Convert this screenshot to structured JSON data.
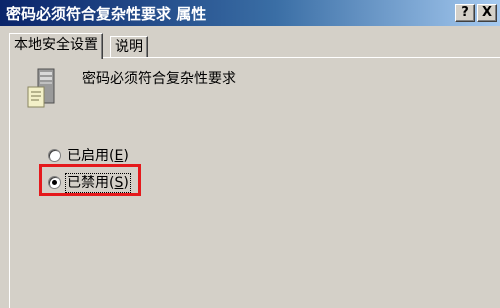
{
  "window": {
    "title": "密码必须符合复杂性要求 属性",
    "help_button": "?",
    "close_button": "X"
  },
  "tabs": [
    {
      "label": "本地安全设置",
      "active": true
    },
    {
      "label": "说明",
      "active": false
    }
  ],
  "policy": {
    "name": "密码必须符合复杂性要求",
    "icon": "policy-server-icon"
  },
  "options": [
    {
      "label": "已启用",
      "hotkey": "E",
      "checked": false
    },
    {
      "label": "已禁用",
      "hotkey": "S",
      "checked": true
    }
  ],
  "annotation_color": "#e5191c"
}
